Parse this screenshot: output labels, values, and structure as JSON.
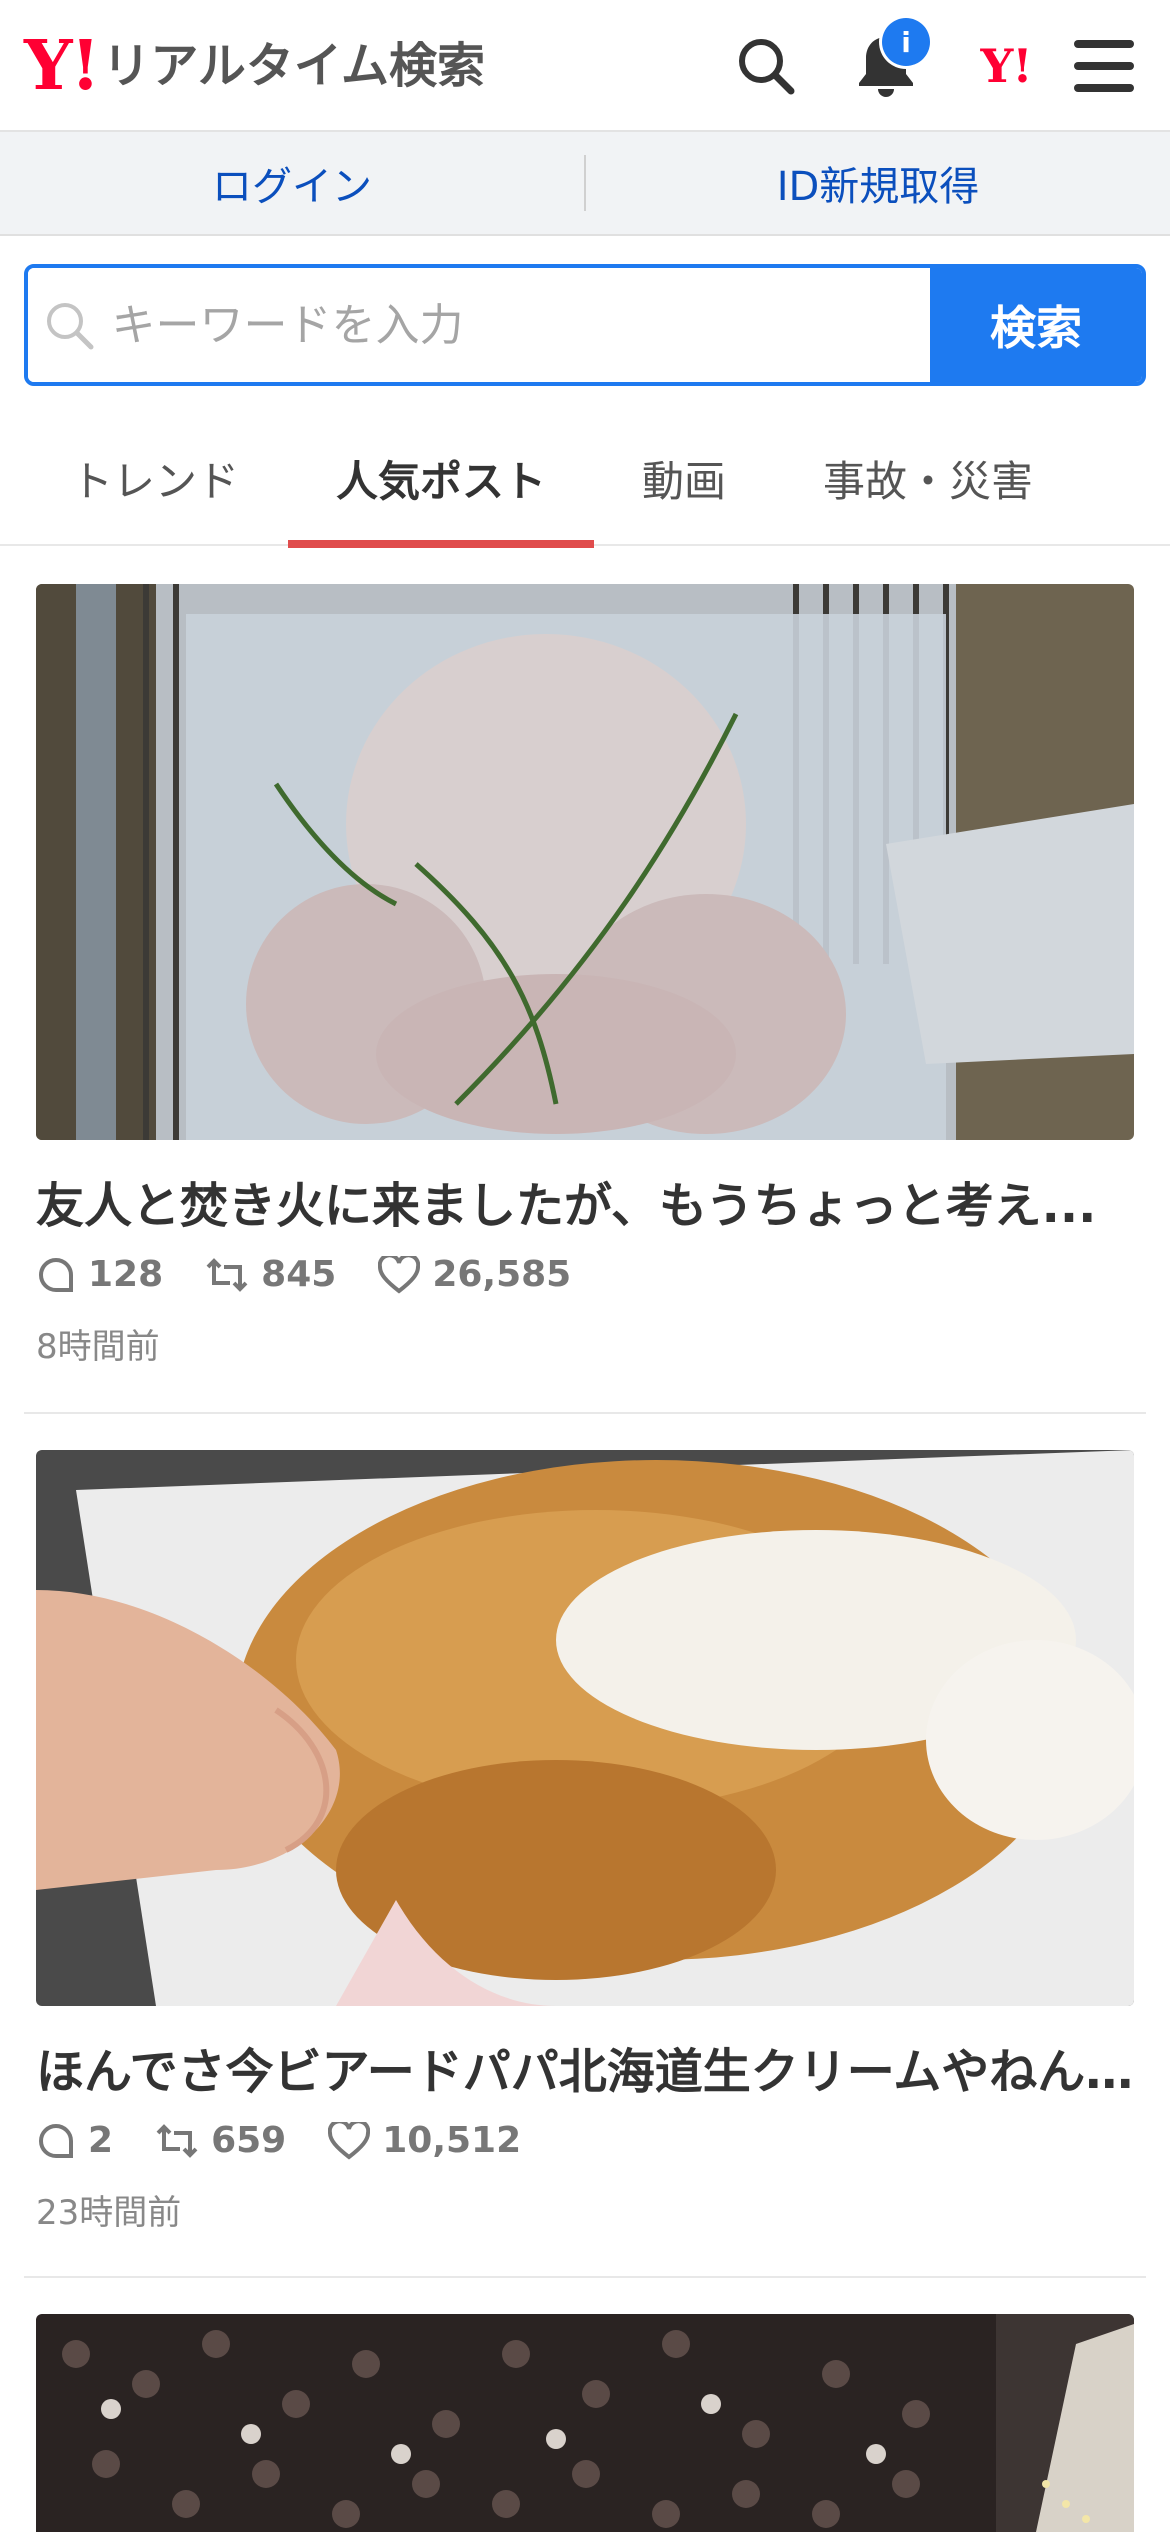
{
  "header": {
    "logo_mark": "Y!",
    "title": "リアルタイム検索",
    "notification_badge": "i",
    "yahoo_mark": "Y!"
  },
  "auth": {
    "login": "ログイン",
    "register": "ID新規取得"
  },
  "search": {
    "placeholder": "キーワードを入力",
    "button": "検索"
  },
  "tabs": [
    {
      "label": "トレンド"
    },
    {
      "label": "人気ポスト"
    },
    {
      "label": "動画"
    },
    {
      "label": "事故・災害"
    }
  ],
  "active_tab": "人気ポスト",
  "posts": [
    {
      "title": "友人と焚き火に来ましたが、もうちょっと考え...",
      "replies": "128",
      "reposts": "845",
      "likes": "26,585",
      "time": "8時間前",
      "image": "roast-chicken-on-grill"
    },
    {
      "title": "ほんでさ今ビアードパパ北海道生クリームやねん...",
      "replies": "2",
      "reposts": "659",
      "likes": "10,512",
      "time": "23時間前",
      "image": "cream-puff-in-hand"
    },
    {
      "image": "crowd-night-event"
    }
  ],
  "colors": {
    "accent": "#1e7af0",
    "brand": "#ff0033",
    "tab_underline": "#e04c4c"
  }
}
